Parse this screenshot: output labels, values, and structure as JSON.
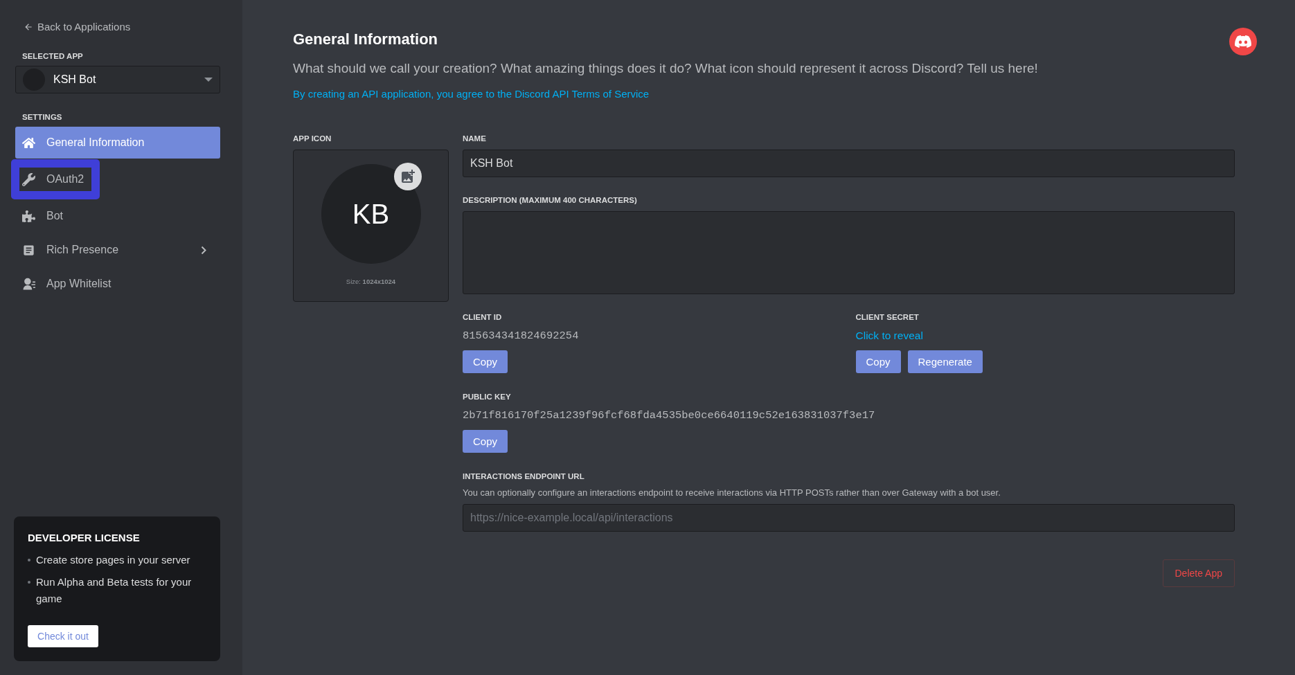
{
  "sidebar": {
    "back_link": "Back to Applications",
    "selected_app_label": "SELECTED APP",
    "selected_app": {
      "name": "KSH Bot"
    },
    "settings_label": "SETTINGS",
    "items": [
      {
        "label": "General Information",
        "selected": true,
        "highlighted": false,
        "has_submenu": false
      },
      {
        "label": "OAuth2",
        "selected": false,
        "highlighted": true,
        "has_submenu": false
      },
      {
        "label": "Bot",
        "selected": false,
        "highlighted": false,
        "has_submenu": false
      },
      {
        "label": "Rich Presence",
        "selected": false,
        "highlighted": false,
        "has_submenu": true
      },
      {
        "label": "App Whitelist",
        "selected": false,
        "highlighted": false,
        "has_submenu": false
      }
    ],
    "license_card": {
      "title": "DEVELOPER LICENSE",
      "bullets": [
        "Create store pages in your server",
        "Run Alpha and Beta tests for your game"
      ],
      "button": "Check it out"
    }
  },
  "main": {
    "title": "General Information",
    "subtitle": "What should we call your creation? What amazing things does it do? What icon should represent it across Discord? Tell us here!",
    "terms_link": "By creating an API application, you agree to the Discord API Terms of Service",
    "app_icon": {
      "label": "APP ICON",
      "initials": "KB",
      "size_prefix": "Size:",
      "size_value": "1024x1024"
    },
    "name": {
      "label": "NAME",
      "value": "KSH Bot"
    },
    "description": {
      "label": "DESCRIPTION (MAXIMUM 400 CHARACTERS)"
    },
    "client_id": {
      "label": "CLIENT ID",
      "value": "815634341824692254",
      "buttons": [
        "Copy"
      ]
    },
    "client_secret": {
      "label": "CLIENT SECRET",
      "reveal_link": "Click to reveal",
      "buttons": [
        "Copy",
        "Regenerate"
      ]
    },
    "public_key": {
      "label": "PUBLIC KEY",
      "value": "2b71f816170f25a1239f96fcf68fda4535be0ce6640119c52e163831037f3e17",
      "buttons": [
        "Copy"
      ]
    },
    "interactions": {
      "label": "INTERACTIONS ENDPOINT URL",
      "help": "You can optionally configure an interactions endpoint to receive interactions via HTTP POSTs rather than over Gateway with a bot user.",
      "placeholder": "https://nice-example.local/api/interactions"
    },
    "delete_button": "Delete App"
  }
}
